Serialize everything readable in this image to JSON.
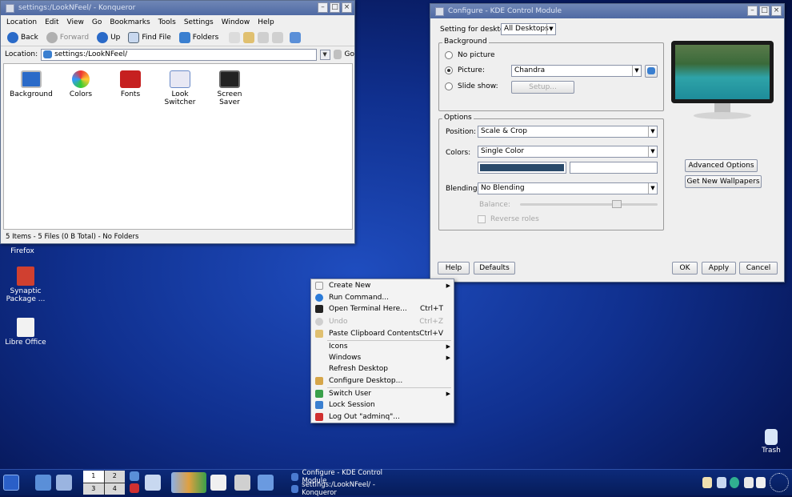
{
  "konqueror": {
    "title": "settings:/LookNFeel/ - Konqueror",
    "menu": [
      "Location",
      "Edit",
      "View",
      "Go",
      "Bookmarks",
      "Tools",
      "Settings",
      "Window",
      "Help"
    ],
    "toolbar": {
      "back": "Back",
      "forward": "Forward",
      "up": "Up",
      "find": "Find File",
      "folders": "Folders"
    },
    "location_label": "Location:",
    "location_value": "settings:/LookNFeel/",
    "go": "Go",
    "files": [
      {
        "label": "Background",
        "icon": "background-icon"
      },
      {
        "label": "Colors",
        "icon": "colors-icon"
      },
      {
        "label": "Fonts",
        "icon": "fonts-icon"
      },
      {
        "label": "Look Switcher",
        "icon": "look-switcher-icon"
      },
      {
        "label": "Screen Saver",
        "icon": "screen-saver-icon"
      }
    ],
    "status": "5 Items - 5 Files (0 B Total) - No Folders"
  },
  "kde": {
    "title": "Configure - KDE Control Module",
    "setting_for": "Setting for desktop:",
    "desktop_select": "All Desktops",
    "background_group": "Background",
    "no_picture": "No picture",
    "picture": "Picture:",
    "picture_value": "Chandra",
    "slide_show": "Slide show:",
    "setup": "Setup...",
    "options_group": "Options",
    "position_label": "Position:",
    "position_value": "Scale & Crop",
    "colors_label": "Colors:",
    "colors_value": "Single Color",
    "color1": "#2a4a6a",
    "blending_label": "Blending:",
    "blending_value": "No Blending",
    "balance_label": "Balance:",
    "reverse_roles": "Reverse roles",
    "advanced": "Advanced Options",
    "get_new": "Get New Wallpapers",
    "help": "Help",
    "defaults": "Defaults",
    "ok": "OK",
    "apply": "Apply",
    "cancel": "Cancel"
  },
  "desktop_icons": [
    {
      "label": "Firefox"
    },
    {
      "label": "Synaptic Package ..."
    },
    {
      "label": "Libre Office"
    },
    {
      "label": "Trash"
    }
  ],
  "context_menu": [
    {
      "label": "Create New",
      "shortcut": "",
      "submenu": true,
      "disabled": false
    },
    {
      "label": "Run Command...",
      "shortcut": "",
      "submenu": false,
      "disabled": false
    },
    {
      "label": "Open Terminal Here...",
      "shortcut": "Ctrl+T",
      "submenu": false,
      "disabled": false
    },
    {
      "label": "Undo",
      "shortcut": "Ctrl+Z",
      "submenu": false,
      "disabled": true
    },
    {
      "label": "Paste Clipboard Contents",
      "shortcut": "Ctrl+V",
      "submenu": false,
      "disabled": false
    },
    {
      "label": "Icons",
      "shortcut": "",
      "submenu": true,
      "disabled": false
    },
    {
      "label": "Windows",
      "shortcut": "",
      "submenu": true,
      "disabled": false
    },
    {
      "label": "Refresh Desktop",
      "shortcut": "",
      "submenu": false,
      "disabled": false
    },
    {
      "label": "Configure Desktop...",
      "shortcut": "",
      "submenu": false,
      "disabled": false
    },
    {
      "label": "Switch User",
      "shortcut": "",
      "submenu": true,
      "disabled": false
    },
    {
      "label": "Lock Session",
      "shortcut": "",
      "submenu": false,
      "disabled": false
    },
    {
      "label": "Log Out \"adminq\"...",
      "shortcut": "",
      "submenu": false,
      "disabled": false
    }
  ],
  "taskbar": {
    "pager": [
      "1",
      "2",
      "3",
      "4"
    ],
    "tasks": [
      {
        "label": "Configure - KDE Control Module"
      },
      {
        "label": "settings:/LookNFeel/ - Konqueror"
      }
    ]
  }
}
